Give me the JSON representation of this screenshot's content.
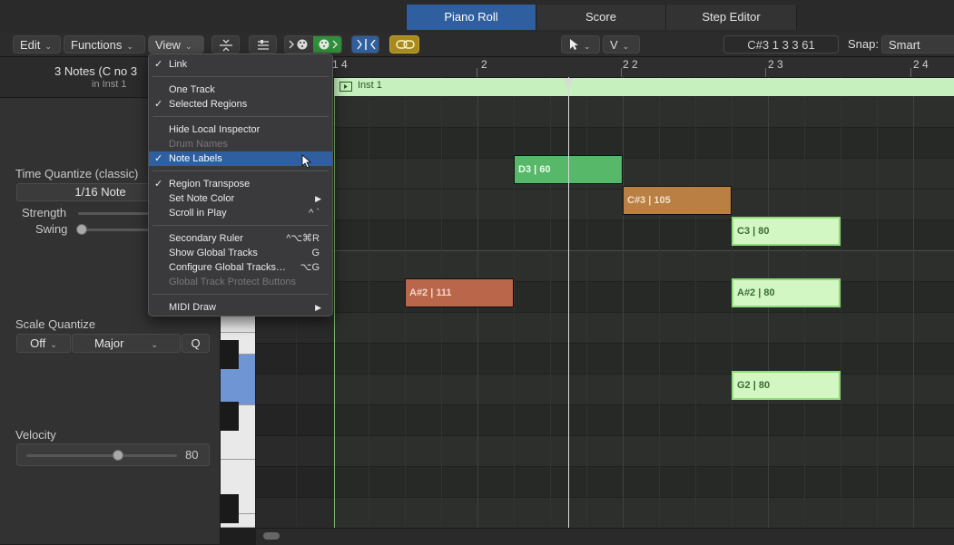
{
  "tabs": [
    {
      "label": "Piano Roll",
      "active": true
    },
    {
      "label": "Score",
      "active": false
    },
    {
      "label": "Step Editor",
      "active": false
    }
  ],
  "toolbar": {
    "edit_label": "Edit",
    "functions_label": "Functions",
    "view_label": "View",
    "tool_label": "V",
    "position_readout": "C#3  1 3 3 61",
    "snap_label": "Snap:",
    "snap_value": "Smart"
  },
  "inspector": {
    "title": "3 Notes (C no 3 ",
    "subtitle": "in Inst 1",
    "time_quantize_label": "Time Quantize (classic)",
    "time_quantize_value": "1/16 Note",
    "strength_label": "Strength",
    "swing_label": "Swing",
    "scale_quantize_label": "Scale Quantize",
    "scale_quantize_off": "Off",
    "scale_quantize_scale": "Major",
    "q_label": "Q",
    "velocity_label": "Velocity",
    "velocity_value": "80"
  },
  "ruler": {
    "labels": [
      "1 4",
      "2",
      "2 2",
      "2 3",
      "2 4"
    ]
  },
  "region": {
    "name": "Inst 1",
    "color": "#c6f0bd"
  },
  "notes": [
    {
      "label": "D3 | 60",
      "color": "#57b86a",
      "text_color": "#e9ffe9"
    },
    {
      "label": "C#3 | 105",
      "color": "#b97f43",
      "text_color": "#f3e1c9"
    },
    {
      "label": "C3 | 80",
      "color": "#d3f7c3",
      "text_color": "#3c6b36"
    },
    {
      "label": "A#2 | 111",
      "color": "#b9664a",
      "text_color": "#f3d7c9"
    },
    {
      "label": "A#2 | 80",
      "color": "#d3f7c3",
      "text_color": "#3c6b36"
    },
    {
      "label": "G2 | 80",
      "color": "#d3f7c3",
      "text_color": "#3c6b36"
    }
  ],
  "view_menu": {
    "items": [
      {
        "label": "Link",
        "checked": true
      },
      {
        "label": "One Track",
        "checked": false
      },
      {
        "label": "Selected Regions",
        "checked": true
      },
      {
        "label": "Hide Local Inspector",
        "checked": false
      },
      {
        "label": "Drum Names",
        "checked": false,
        "disabled": true
      },
      {
        "label": "Note Labels",
        "checked": true,
        "highlighted": true
      },
      {
        "label": "Region Transpose",
        "checked": true
      },
      {
        "label": "Set Note Color",
        "submenu": true
      },
      {
        "label": "Scroll in Play",
        "shortcut": "^ `"
      },
      {
        "label": "Secondary Ruler",
        "shortcut": "^⌥⌘R"
      },
      {
        "label": "Show Global Tracks",
        "shortcut": "G"
      },
      {
        "label": "Configure Global Tracks…",
        "shortcut": "⌥G"
      },
      {
        "label": "Global Track Protect Buttons",
        "disabled": true
      },
      {
        "label": "MIDI Draw",
        "submenu": true
      }
    ]
  },
  "colors": {
    "accent": "#2f5f9e",
    "region_green": "#c6f0bd",
    "selected_key": "#6f95d4"
  }
}
